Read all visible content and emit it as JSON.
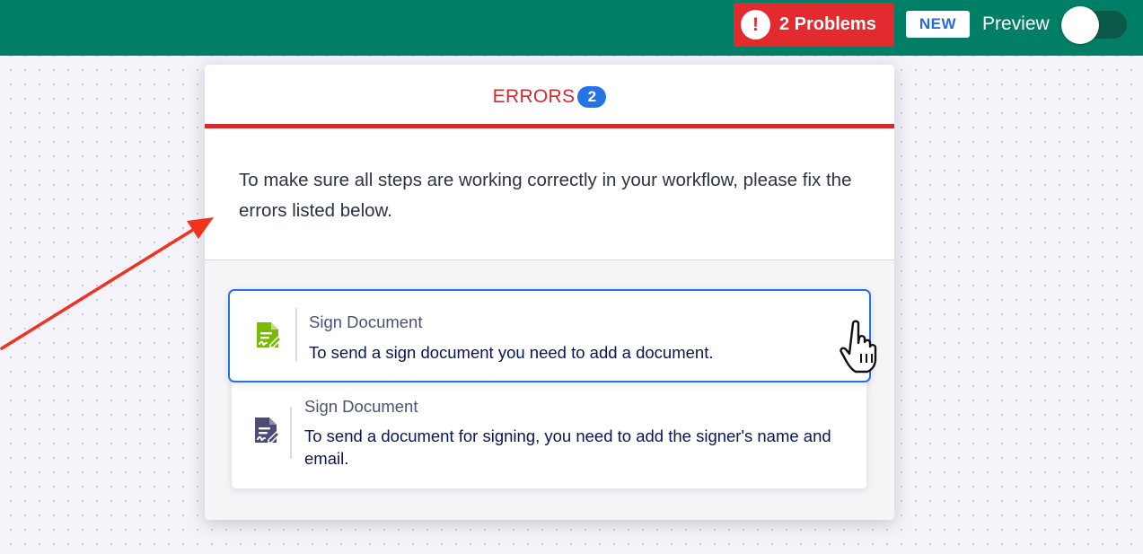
{
  "topbar": {
    "problems_label": "2 Problems",
    "problems_icon": "exclamation-circle-icon",
    "problems_icon_glyph": "!",
    "new_badge": "NEW",
    "preview_label": "Preview",
    "preview_toggle_on": false
  },
  "modal": {
    "title": "ERRORS",
    "error_count": "2",
    "description": "To make sure all steps are working correctly in your workflow, please fix the errors listed below."
  },
  "errors": [
    {
      "icon": "sign-document-icon",
      "icon_color": "#78bb07",
      "title": "Sign Document",
      "message": "To send a sign document you need to add a document."
    },
    {
      "icon": "sign-document-icon",
      "icon_color": "#4c4c78",
      "title": "Sign Document",
      "message": "To send a document for signing, you need to add the signer's name and email."
    }
  ],
  "colors": {
    "topbar": "#017e66",
    "error_red": "#d42a2f",
    "accent_blue": "#2474e5",
    "annotation_arrow": "#f0321f"
  }
}
